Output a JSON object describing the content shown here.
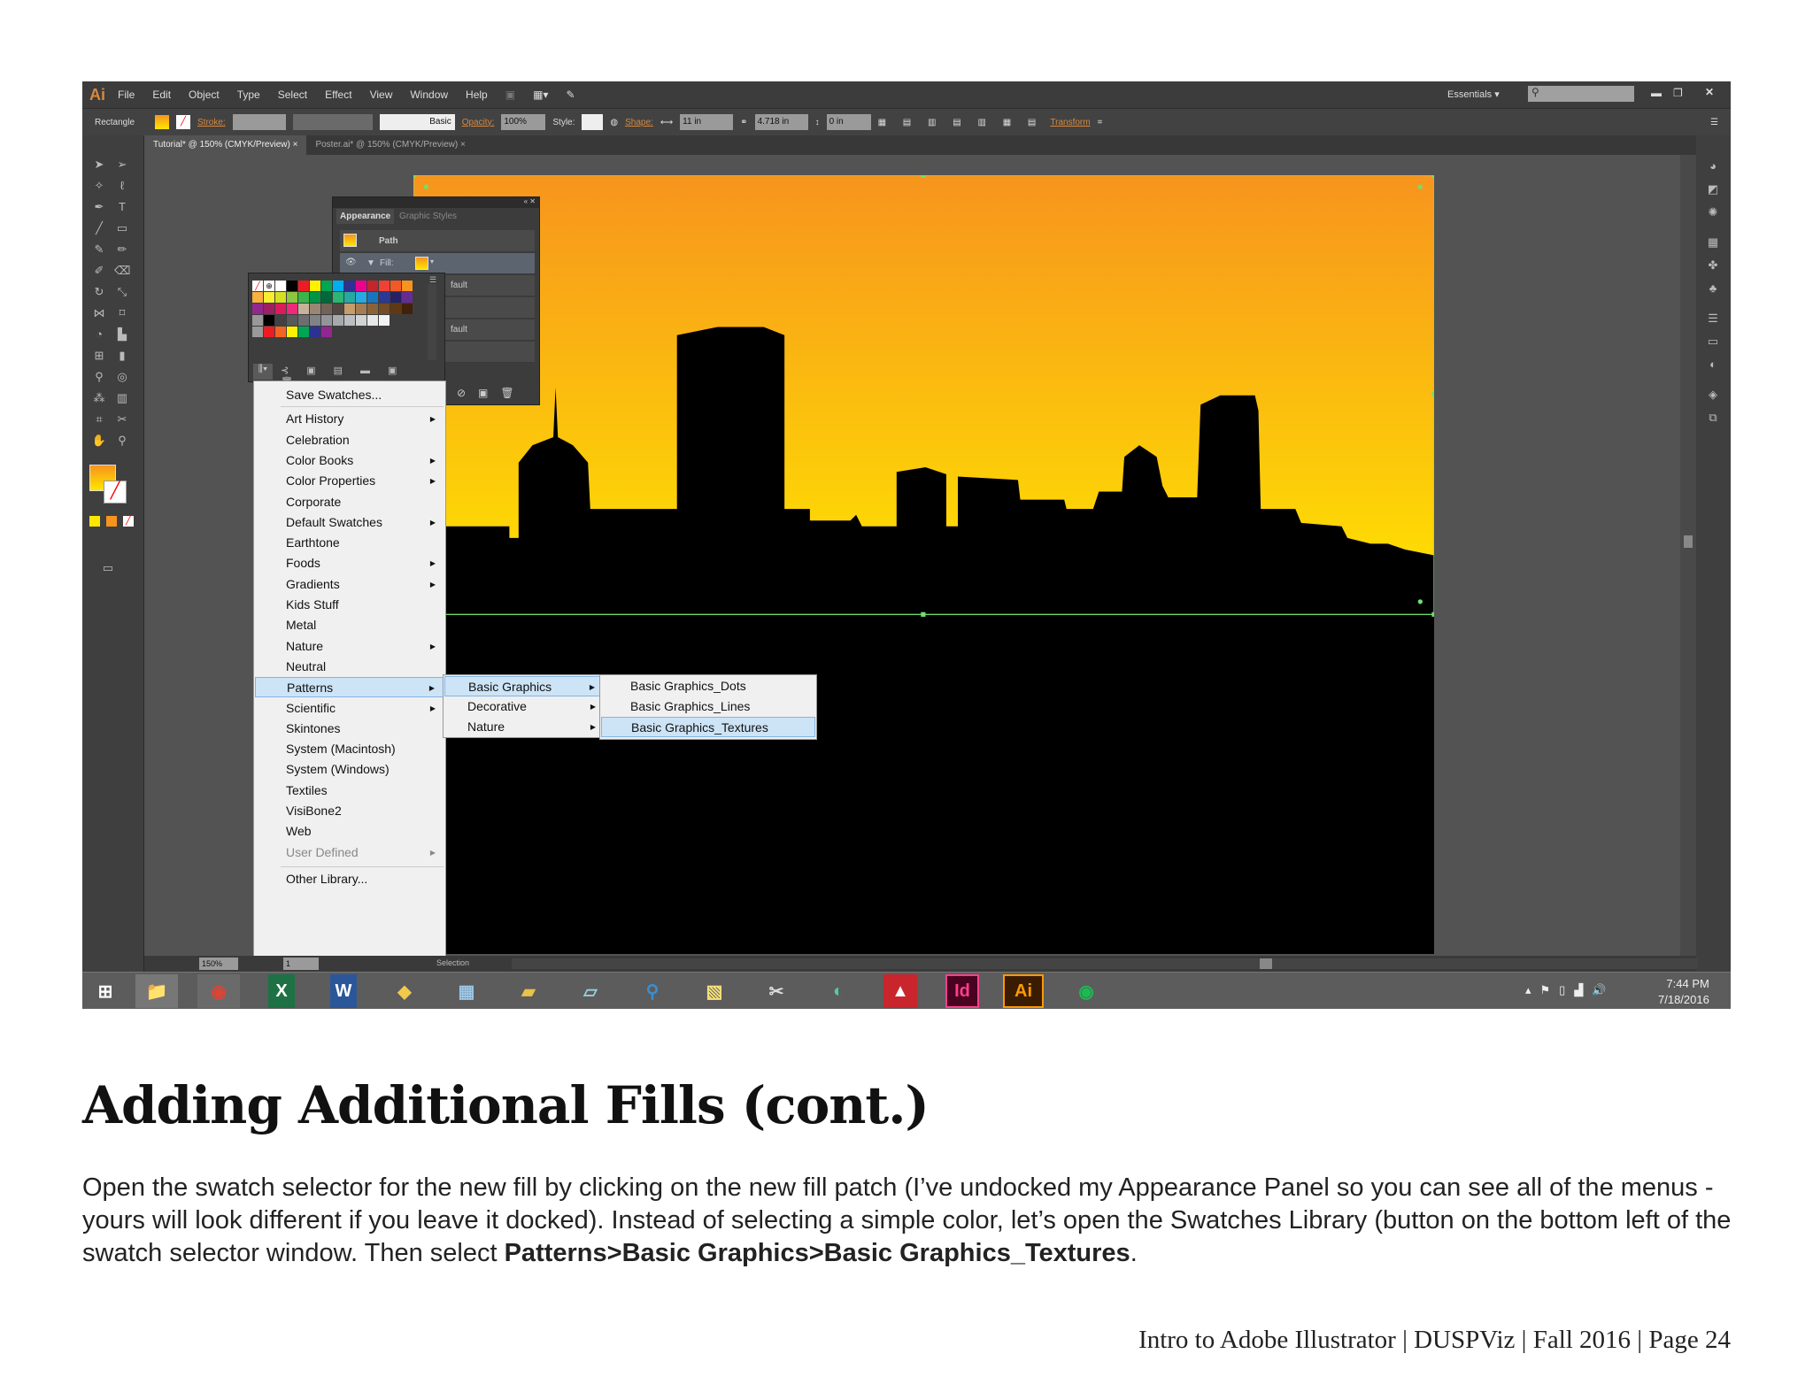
{
  "app": {
    "logo": "Ai",
    "menu": [
      "File",
      "Edit",
      "Object",
      "Type",
      "Select",
      "Effect",
      "View",
      "Window",
      "Help"
    ],
    "workspace": "Essentials"
  },
  "control_bar": {
    "object_type": "Rectangle",
    "stroke_label": "Stroke:",
    "stroke_style": "Basic",
    "opacity_label": "Opacity:",
    "opacity": "100%",
    "style_label": "Style:",
    "shape_label": "Shape:",
    "width": "11 in",
    "height": "4.718 in",
    "corner": "0 in",
    "transform_label": "Transform"
  },
  "tabs": [
    {
      "label": "Tutorial* @ 150% (CMYK/Preview)",
      "close": "×"
    },
    {
      "label": "Poster.ai* @ 150% (CMYK/Preview)",
      "close": "×"
    }
  ],
  "appearance": {
    "tab1": "Appearance",
    "tab2": "Graphic Styles",
    "path": "Path",
    "fill": "Fill:",
    "default1": "fault",
    "default2": "fault"
  },
  "swatches": {
    "rows": [
      [
        "#ffffff",
        "#000000",
        "#ed1c24",
        "#fff200",
        "#00a651",
        "#00aeef",
        "#2e3192",
        "#ec008c",
        "#c1272d",
        "#ef4136",
        "#f15a24",
        "#f7941d"
      ],
      [
        "#fbb040",
        "#f9ed32",
        "#d7df23",
        "#8dc63f",
        "#39b54a",
        "#009444",
        "#006838",
        "#2bb673",
        "#26a9a0",
        "#27aae1",
        "#1c75bc",
        "#2b3990",
        "#262262",
        "#662d91"
      ],
      [
        "#92278f",
        "#9e1f63",
        "#da1c5c",
        "#ee2a7b",
        "#c7b299",
        "#998675",
        "#736357",
        "#534741",
        "#c69c6d",
        "#a67c52",
        "#8c6239",
        "#754c24",
        "#603813",
        "#42210b"
      ],
      [
        "#000000",
        "#414042",
        "#58595b",
        "#6d6e71",
        "#808285",
        "#939598",
        "#a7a9ac",
        "#bcbec0",
        "#d1d3d4",
        "#e6e7e8",
        "#f1f2f2"
      ],
      [
        "#ed1c24",
        "#f26522",
        "#fff200",
        "#00a651",
        "#2e3192",
        "#92278f"
      ]
    ]
  },
  "library_menu": {
    "items": [
      {
        "label": "Save Swatches...",
        "sub": false
      },
      {
        "label": "Art History",
        "sub": true
      },
      {
        "label": "Celebration",
        "sub": false
      },
      {
        "label": "Color Books",
        "sub": true
      },
      {
        "label": "Color Properties",
        "sub": true
      },
      {
        "label": "Corporate",
        "sub": false
      },
      {
        "label": "Default Swatches",
        "sub": true
      },
      {
        "label": "Earthtone",
        "sub": false
      },
      {
        "label": "Foods",
        "sub": true
      },
      {
        "label": "Gradients",
        "sub": true
      },
      {
        "label": "Kids Stuff",
        "sub": false
      },
      {
        "label": "Metal",
        "sub": false
      },
      {
        "label": "Nature",
        "sub": true
      },
      {
        "label": "Neutral",
        "sub": false
      },
      {
        "label": "Patterns",
        "sub": true,
        "selected": true
      },
      {
        "label": "Scientific",
        "sub": true
      },
      {
        "label": "Skintones",
        "sub": false
      },
      {
        "label": "System (Macintosh)",
        "sub": false
      },
      {
        "label": "System (Windows)",
        "sub": false
      },
      {
        "label": "Textiles",
        "sub": false
      },
      {
        "label": "VisiBone2",
        "sub": false
      },
      {
        "label": "Web",
        "sub": false
      },
      {
        "label": "User Defined",
        "sub": true,
        "disabled": true
      },
      {
        "label": "Other Library...",
        "sub": false
      }
    ],
    "patterns_sub": [
      "Basic Graphics",
      "Decorative",
      "Nature"
    ],
    "basic_graphics_sub": [
      "Basic Graphics_Dots",
      "Basic Graphics_Lines",
      "Basic Graphics_Textures"
    ]
  },
  "status": {
    "zoom": "150%",
    "page": "1",
    "tool": "Selection"
  },
  "taskbar": {
    "time": "7:44 PM",
    "date": "7/18/2016",
    "apps": [
      "windows",
      "explorer",
      "chrome",
      "excel",
      "word",
      "app",
      "calculator",
      "archive",
      "notepad",
      "search",
      "sticky",
      "snipping",
      "network",
      "acrobat",
      "indesign",
      "illustrator",
      "spotify"
    ]
  },
  "doc": {
    "heading": "Adding Additional Fills (cont.)",
    "body_pre": "Open the swatch selector for the new fill by clicking on the new fill patch (I’ve undocked my Appearance Panel so you can see all of the menus - yours will look different if you leave it docked). Instead of selecting a simple color, let’s open the Swatches Library (button on the bottom left of the swatch selector window. Then select ",
    "body_bold": "Patterns>Basic Graphics>Basic Graphics_Textures",
    "body_post": ".",
    "footer": "Intro to Adobe Illustrator | DUSPViz | Fall 2016 | Page 24"
  },
  "colors": {
    "accent": "#d9883c",
    "gradient_top": "#f7941d",
    "gradient_bottom": "#ffe600",
    "selection": "#6fe06f"
  }
}
